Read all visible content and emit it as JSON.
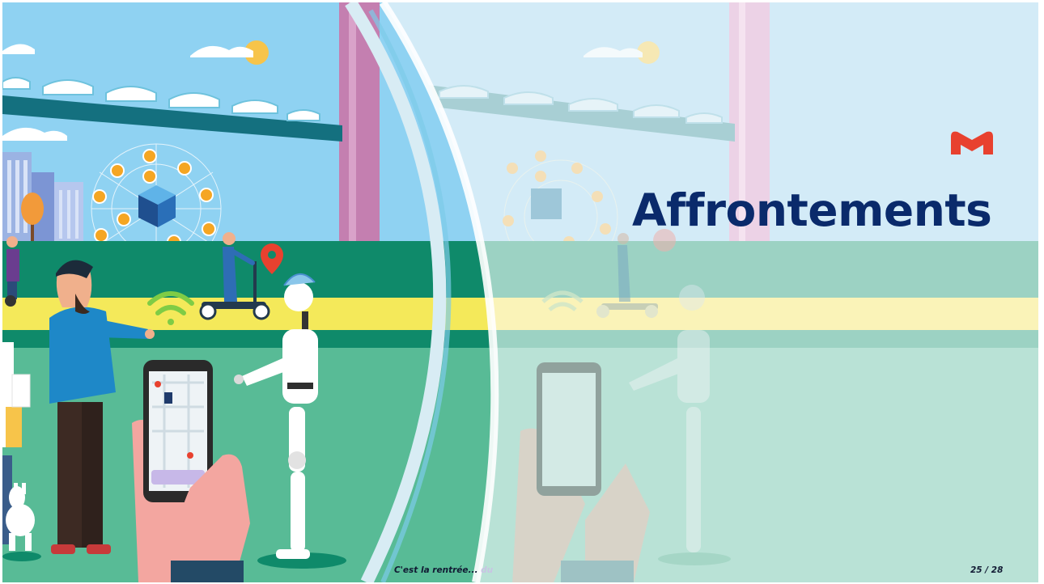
{
  "slide": {
    "title": "Affrontements",
    "footer_text": "C'est la rentrée...",
    "footer_faint": "du",
    "page_number": "25 / 28"
  },
  "colors": {
    "title": "#0a2a6b",
    "logo": "#e8412f",
    "sky": "#8fd2f2",
    "ground_green": "#58bb96",
    "band_green": "#0f8a6a",
    "road_yellow": "#f4e95a"
  },
  "icons": {
    "logo": "m-logo-icon",
    "illustration": "smart-city-illustration"
  }
}
